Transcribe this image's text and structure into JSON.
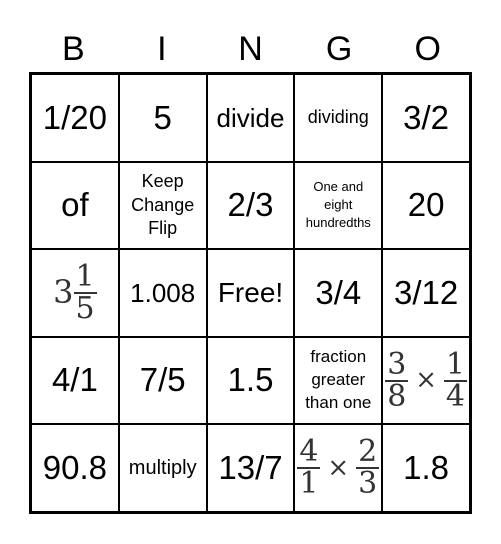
{
  "header": [
    "B",
    "I",
    "N",
    "G",
    "O"
  ],
  "cells": [
    {
      "text": "1/20"
    },
    {
      "text": "5"
    },
    {
      "text": "divide"
    },
    {
      "text": "dividing"
    },
    {
      "text": "3/2"
    },
    {
      "text": "of"
    },
    {
      "text": "Keep Change Flip"
    },
    {
      "text": "2/3"
    },
    {
      "text": "One and eight hundredths"
    },
    {
      "text": "20"
    },
    {
      "whole": "3",
      "num": "1",
      "den": "5"
    },
    {
      "text": "1.008"
    },
    {
      "text": "Free!"
    },
    {
      "text": "3/4"
    },
    {
      "text": "3/12"
    },
    {
      "text": "4/1"
    },
    {
      "text": "7/5"
    },
    {
      "text": "1.5"
    },
    {
      "text": "fraction greater than one"
    },
    {
      "a_num": "3",
      "a_den": "8",
      "op": "×",
      "b_num": "1",
      "b_den": "4"
    },
    {
      "text": "90.8"
    },
    {
      "text": "multiply"
    },
    {
      "text": "13/7"
    },
    {
      "a_num": "4",
      "a_den": "1",
      "op": "×",
      "b_num": "2",
      "b_den": "3"
    },
    {
      "text": "1.8"
    }
  ]
}
